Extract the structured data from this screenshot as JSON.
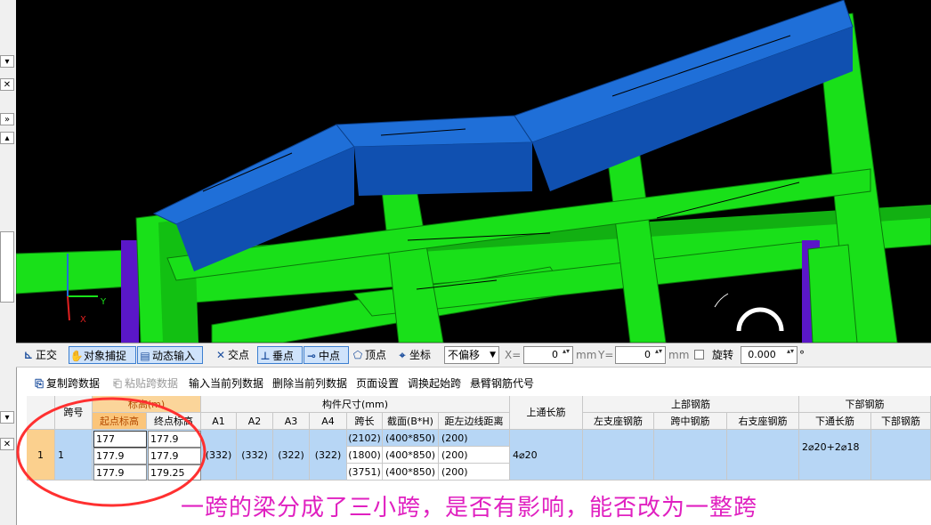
{
  "toolbar1": {
    "ortho": "正交",
    "snap": "对象捕捉",
    "dynamic_input": "动态输入",
    "intersection": "交点",
    "perpendicular": "垂点",
    "midpoint": "中点",
    "vertex": "顶点",
    "coordinate": "坐标",
    "offset_mode": "不偏移",
    "x_label": "X=",
    "x_value": "0",
    "x_unit": "mm",
    "y_label": "Y=",
    "y_value": "0",
    "y_unit": "mm",
    "rotate_label": "旋转",
    "rotate_value": "0.000",
    "rotate_unit": "°"
  },
  "toolbar2": {
    "copy_span": "复制跨数据",
    "paste_span": "粘贴跨数据",
    "input_column": "输入当前列数据",
    "delete_column": "删除当前列数据",
    "page_setup": "页面设置",
    "swap_start": "调换起始跨",
    "cantilever": "悬臂钢筋代号"
  },
  "table": {
    "headers": {
      "span_no": "跨号",
      "elevation_group": "标高(m)",
      "start_elev": "起点标高",
      "end_elev": "终点标高",
      "size_group": "构件尺寸(mm)",
      "a1": "A1",
      "a2": "A2",
      "a3": "A3",
      "a4": "A4",
      "span_len": "跨长",
      "section": "截面(B*H)",
      "left_dist": "距左边线距离",
      "top_through": "上通长筋",
      "top_group": "上部钢筋",
      "left_support": "左支座钢筋",
      "mid_span": "跨中钢筋",
      "right_support": "右支座钢筋",
      "bottom_group": "下部钢筋",
      "bottom_through": "下通长筋",
      "bottom_rebar": "下部钢筋"
    },
    "row": {
      "index": "1",
      "span_no": "1",
      "a1": "(332)",
      "a2": "(332)",
      "a3": "(322)",
      "a4": "(322)",
      "top_through": "4⌀20",
      "bottom_through": "2⌀20+2⌀18",
      "subrows": [
        {
          "start": "177",
          "end": "177.9",
          "span": "(2102)",
          "section": "(400*850)",
          "left": "(200)"
        },
        {
          "start": "177.9",
          "end": "177.9",
          "span": "(1800)",
          "section": "(400*850)",
          "left": "(200)"
        },
        {
          "start": "177.9",
          "end": "179.25",
          "span": "(3751)",
          "section": "(400*850)",
          "left": "(200)"
        }
      ]
    }
  },
  "annotation": "一跨的梁分成了三小跨，是否有影响，能否改为一整跨",
  "colors": {
    "beam_blue": "#1f6fd8",
    "beam_green": "#19e019",
    "column_purple": "#5a17c8",
    "annotation": "#e020c0",
    "circle": "#ff3030"
  }
}
